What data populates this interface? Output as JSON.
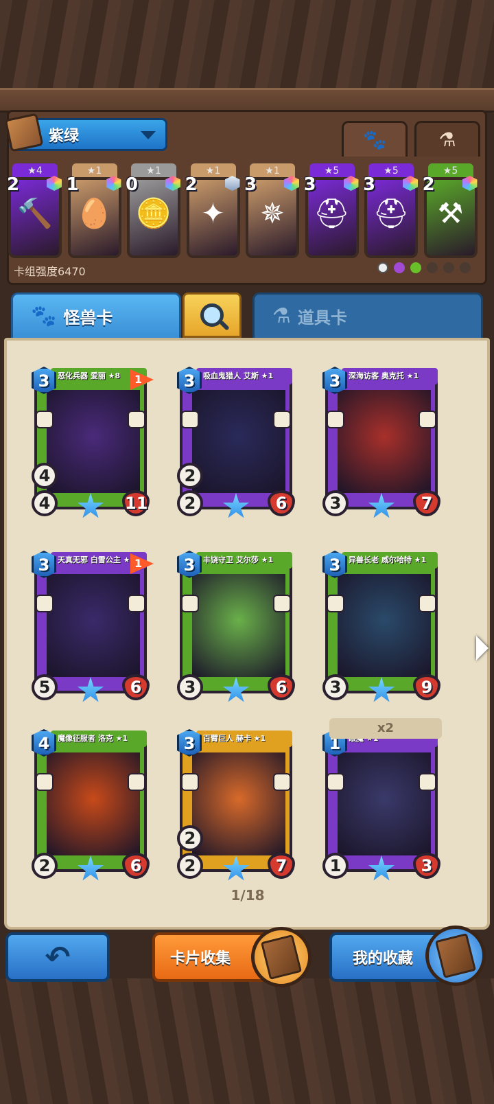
{
  "deck": {
    "name": "紫绿",
    "power_label": "卡组强度6470"
  },
  "type_tabs": {
    "monster_icon": "paw-icon",
    "item_icon": "potion-icon"
  },
  "deck_cards": [
    {
      "stars": "★4",
      "cost": "2",
      "glyph": "🔨",
      "frame": "#7a2ad6",
      "gem": "rainbow"
    },
    {
      "stars": "★1",
      "cost": "1",
      "glyph": "🥚",
      "frame": "#c99a6a",
      "gem": "rainbow"
    },
    {
      "stars": "★1",
      "cost": "0",
      "glyph": "🪙",
      "frame": "#9a9a9a",
      "gem": "rainbow"
    },
    {
      "stars": "★1",
      "cost": "2",
      "glyph": "✦",
      "frame": "#c99a6a",
      "gem": "silver"
    },
    {
      "stars": "★1",
      "cost": "3",
      "glyph": "✵",
      "frame": "#c99a6a",
      "gem": "rainbow"
    },
    {
      "stars": "★5",
      "cost": "3",
      "glyph": "⛑",
      "frame": "#7a2ad6",
      "gem": "rainbow"
    },
    {
      "stars": "★5",
      "cost": "3",
      "glyph": "⛑",
      "frame": "#7a2ad6",
      "gem": "rainbow"
    },
    {
      "stars": "★5",
      "cost": "2",
      "glyph": "⚒",
      "frame": "#5aa82a",
      "gem": "rainbow"
    }
  ],
  "category_tabs": {
    "monster": "怪兽卡",
    "item": "道具卡"
  },
  "cards": [
    {
      "name": "恶化兵器 爱丽 ★8",
      "cost": "3",
      "flag": "1",
      "speed": "4",
      "attack": "4",
      "hp": "11",
      "frame": "#5aa82a",
      "art": "#4a2a7a"
    },
    {
      "name": "吸血鬼猎人 艾斯 ★1",
      "cost": "3",
      "flag": "",
      "speed": "2",
      "attack": "2",
      "hp": "6",
      "frame": "#7a3ac6",
      "art": "#2a2a5a"
    },
    {
      "name": "深海访客 奥克托 ★1",
      "cost": "3",
      "flag": "",
      "speed": "",
      "attack": "3",
      "hp": "7",
      "frame": "#7a3ac6",
      "art": "#a8302a"
    },
    {
      "name": "天真无邪 白雪公主 ★8",
      "cost": "3",
      "flag": "1",
      "speed": "",
      "attack": "5",
      "hp": "6",
      "frame": "#7a3ac6",
      "art": "#3a2a6a"
    },
    {
      "name": "丰饶守卫 艾尔莎 ★1",
      "cost": "3",
      "flag": "",
      "speed": "",
      "attack": "3",
      "hp": "6",
      "frame": "#5aa82a",
      "art": "#6ab04a"
    },
    {
      "name": "异兽长老 威尔哈特 ★1",
      "cost": "3",
      "flag": "",
      "speed": "",
      "attack": "3",
      "hp": "9",
      "frame": "#5aa82a",
      "art": "#2a4a6a"
    },
    {
      "name": "魔像征服者 洛克 ★1",
      "cost": "4",
      "flag": "",
      "speed": "",
      "attack": "2",
      "hp": "6",
      "frame": "#5aa82a",
      "art": "#c84a1a"
    },
    {
      "name": "百臂巨人 赫卡 ★1",
      "cost": "3",
      "flag": "",
      "speed": "2",
      "attack": "2",
      "hp": "7",
      "frame": "#e0a020",
      "art": "#d86a2a"
    },
    {
      "name": "眼魔 ★1",
      "cost": "1",
      "flag": "",
      "speed": "",
      "attack": "1",
      "hp": "3",
      "frame": "#7a3ac6",
      "art": "#3a3a6a"
    }
  ],
  "copies_label": "x2",
  "pagination": "1/18",
  "buttons": {
    "back_icon": "back-arrow-icon",
    "collect": "卡片收集",
    "my_collection": "我的收藏"
  }
}
